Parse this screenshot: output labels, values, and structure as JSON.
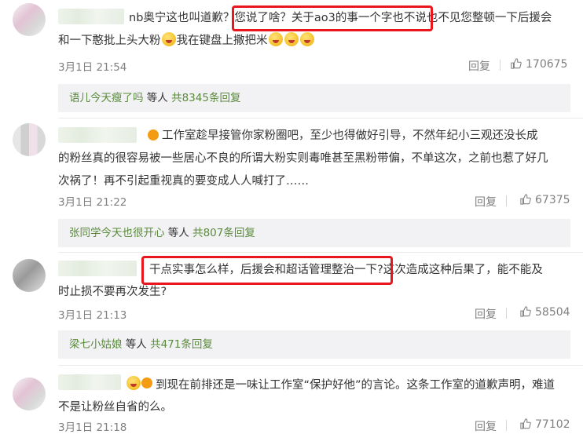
{
  "comments": [
    {
      "name_suffix": "nb奥宁",
      "line1": "这也叫道歉？",
      "line1_quote": "您说了啥？关于ao3的事一个字也不说",
      "line1_rest": "也不见您整顿一下后援会",
      "line2": "和一下憨批上头大粉",
      "line2_rest": "我在键盘上撒把米",
      "time": "3月1日 21:54",
      "reply": "回复",
      "likes": "170675",
      "sub_user": "语儿今天瘦了吗",
      "sub_text": " 等人 ",
      "sub_count": "共8345条回复"
    },
    {
      "line1": "工作室趁早接管你家粉圈吧，至少也得做好引导，不然年纪小三观还没长成",
      "line2": "的粉丝真的很容易被一些居心不良的所谓大粉实则毒唯甚至黑粉带偏，不单这次，之前也惹了好几",
      "line3": "次祸了！再不引起重视真的要变成人人喊打了……",
      "time": "3月1日 21:22",
      "reply": "回复",
      "likes": "67375",
      "sub_user": "张同学今天也很开心",
      "sub_text": " 等人 ",
      "sub_count": "共807条回复"
    },
    {
      "line1_quote": "干点实事怎么样，后援会和超话管理整治一下?",
      "line1_rest": "这次造成这种后果了，能不能及",
      "line2": "时止损不要再次发生?",
      "time": "3月1日 21:13",
      "reply": "回复",
      "likes": "58504",
      "sub_user": "梁七小姑娘",
      "sub_text": " 等人 ",
      "sub_count": "共471条回复"
    },
    {
      "line1": "到现在前排还是一味让工作室“保护好他”的言论。这条工作室的道歉声明，难道",
      "line2": "不是让粉丝自省的么。",
      "time": "3月1日 21:18",
      "reply": "回复",
      "likes": "77102"
    }
  ]
}
